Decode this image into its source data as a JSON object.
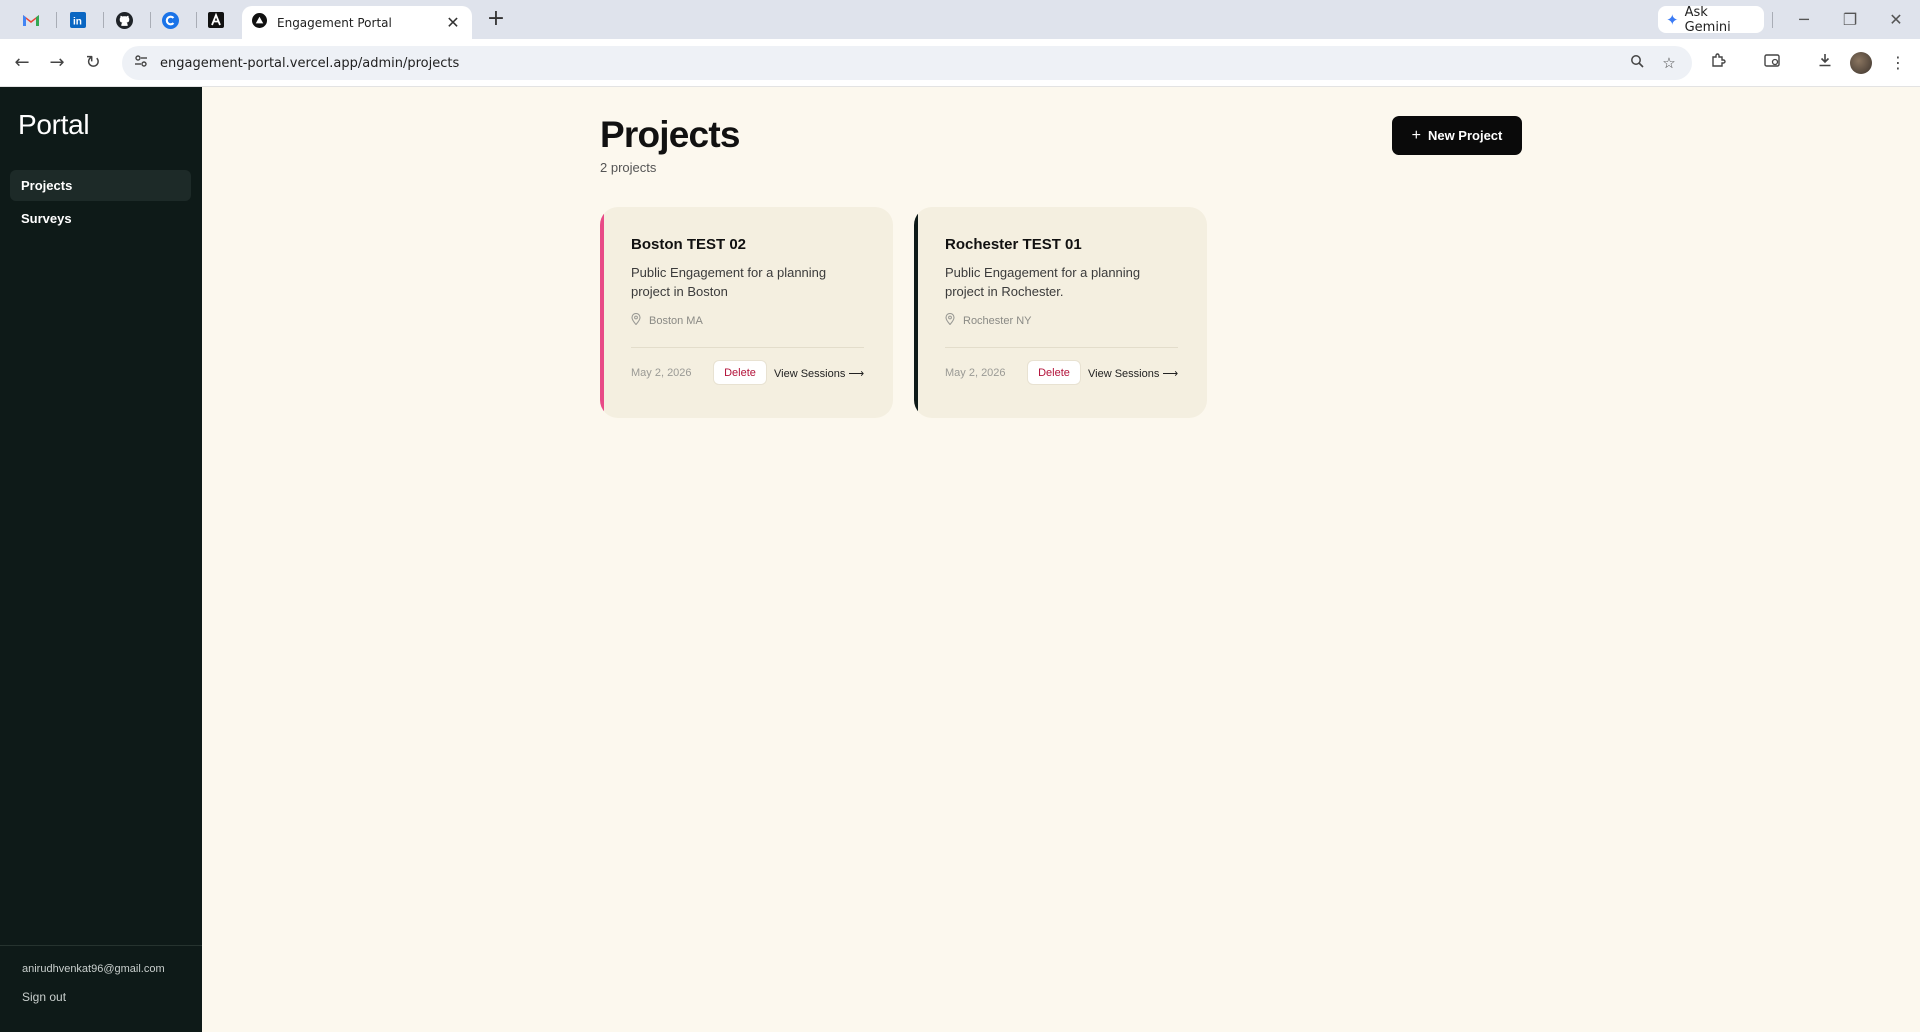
{
  "browser": {
    "tab_title": "Engagement Portal",
    "tab_close": "✕",
    "new_tab": "+",
    "gemini_label": "Ask Gemini",
    "url": "engagement-portal.vercel.app/admin/projects",
    "pinned_tabs": [
      "gmail-icon",
      "linkedin-icon",
      "github-icon",
      "c-app-icon",
      "a-app-icon"
    ]
  },
  "sidebar": {
    "brand": "Portal",
    "items": [
      {
        "label": "Projects",
        "active": true
      },
      {
        "label": "Surveys",
        "active": false
      }
    ],
    "user_email": "anirudhvenkat96@gmail.com",
    "sign_out": "Sign out"
  },
  "main": {
    "title": "Projects",
    "subtitle": "2 projects",
    "new_project_label": "New Project"
  },
  "projects": [
    {
      "name": "Boston TEST 02",
      "description": "Public Engagement for a planning project in Boston",
      "location": "Boston MA",
      "date": "May 2, 2026",
      "delete_label": "Delete",
      "view_label": "View Sessions ⟶",
      "accent": "#e84a87"
    },
    {
      "name": "Rochester TEST 01",
      "description": "Public Engagement for a planning project in Rochester.",
      "location": "Rochester NY",
      "date": "May 2, 2026",
      "delete_label": "Delete",
      "view_label": "View Sessions ⟶",
      "accent": "#0e1a18"
    }
  ],
  "colors": {
    "sidebar_bg": "#0e1a18",
    "page_bg": "#fcf8ee",
    "card_bg": "#f4efe0",
    "delete_text": "#b3123a",
    "primary_button": "#0a0a0a"
  }
}
